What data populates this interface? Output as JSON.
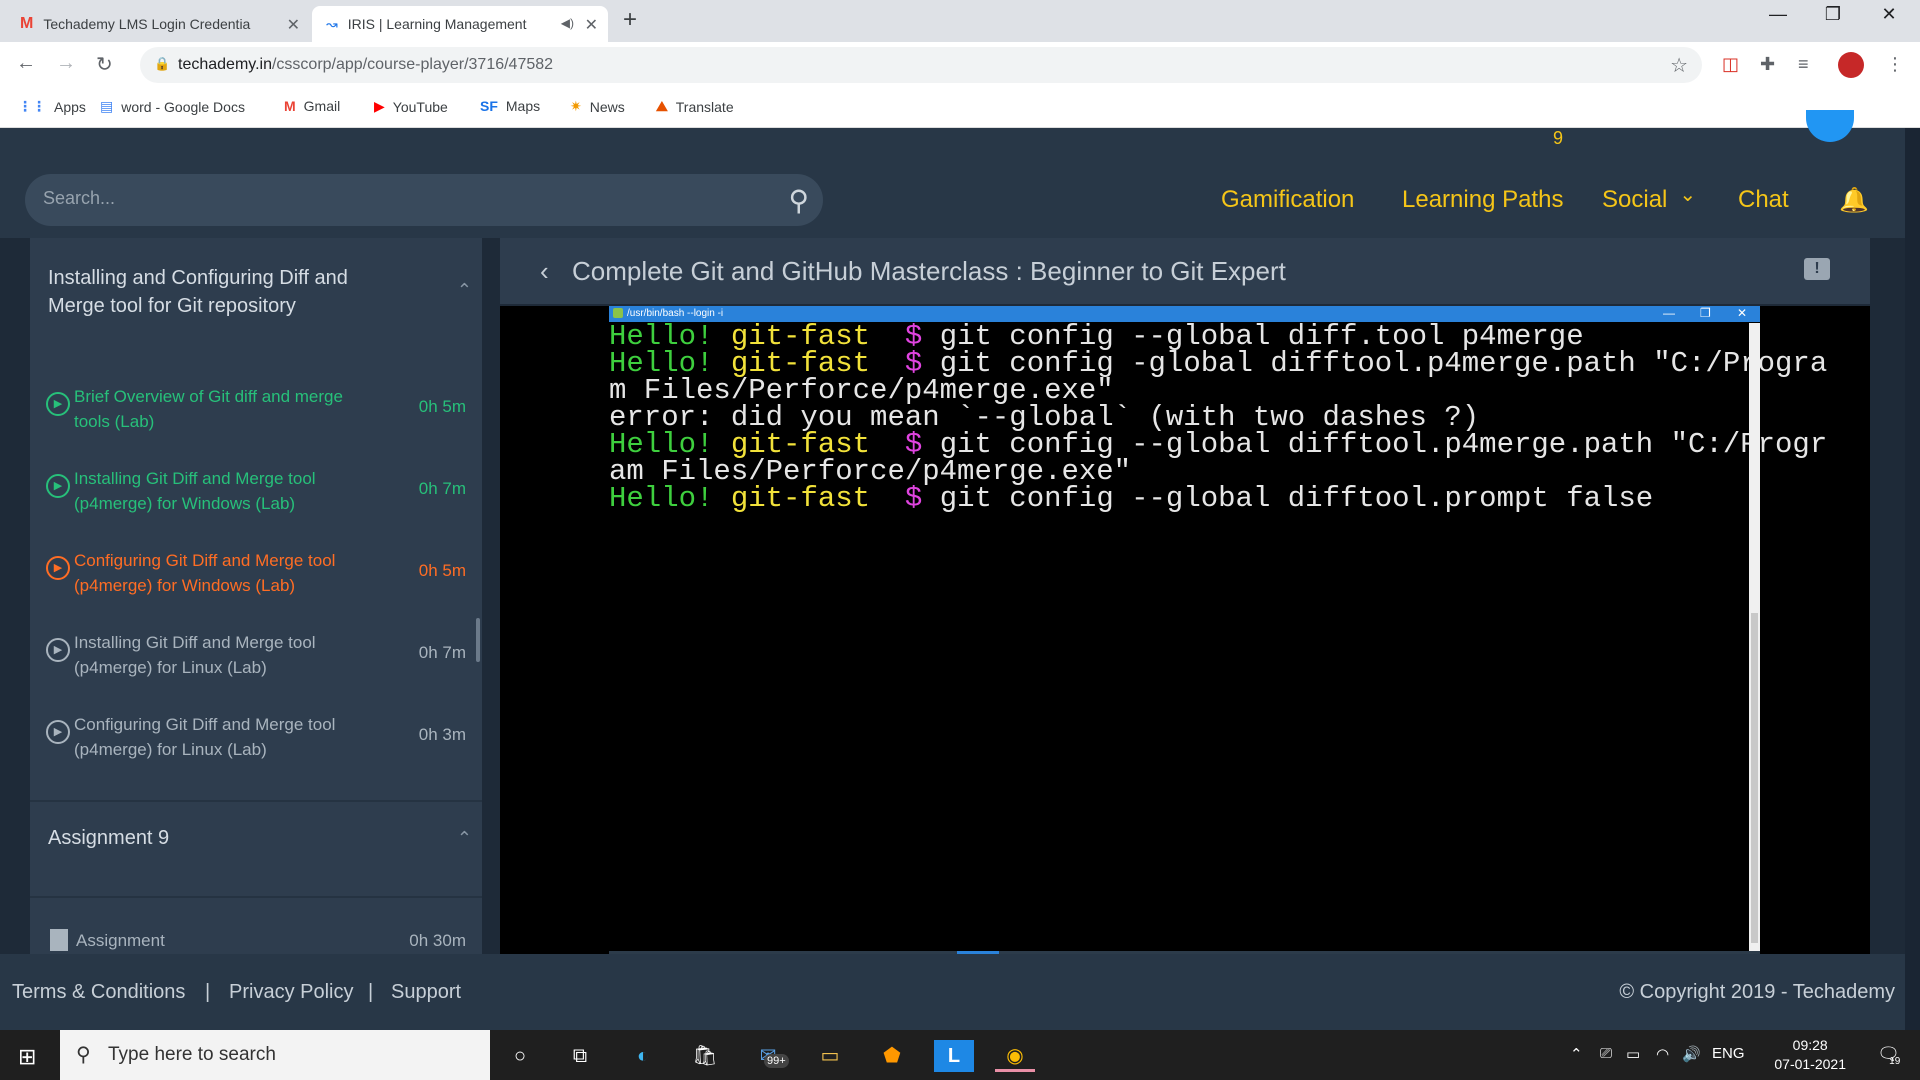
{
  "browser": {
    "tabs": [
      {
        "title": "Techademy LMS Login Credentia",
        "icon": "gmail-icon"
      },
      {
        "title": "IRIS | Learning Management",
        "icon": "iris-icon"
      }
    ],
    "url_host": "techademy.in",
    "url_path": "/csscorp/app/course-player/3716/47582",
    "bookmarks": [
      "Apps",
      "word - Google Docs",
      "Gmail",
      "YouTube",
      "Maps",
      "News",
      "Translate"
    ],
    "bookmark_prefix_maps": "SF"
  },
  "header": {
    "count": "9",
    "search_placeholder": "Search...",
    "nav": [
      "Gamification",
      "Learning Paths",
      "Social",
      "Chat"
    ],
    "social_chevron": "⌄"
  },
  "sidebar": {
    "section1_title": "Installing and Configuring Diff and Merge tool for Git repository",
    "lessons": [
      {
        "name": "Brief Overview of Git diff and merge tools (Lab)",
        "duration": "0h 5m",
        "state": "done"
      },
      {
        "name": "Installing Git Diff and Merge tool (p4merge) for Windows (Lab)",
        "duration": "0h 7m",
        "state": "done"
      },
      {
        "name": "Configuring Git Diff and Merge tool (p4merge) for Windows (Lab)",
        "duration": "0h 5m",
        "state": "current"
      },
      {
        "name": "Installing Git Diff and Merge tool (p4merge) for Linux (Lab)",
        "duration": "0h 7m",
        "state": "pending"
      },
      {
        "name": "Configuring Git Diff and Merge tool (p4merge) for Linux (Lab)",
        "duration": "0h 3m",
        "state": "pending"
      }
    ],
    "section2_title": "Assignment 9",
    "assignment": {
      "name": "Assignment",
      "duration": "0h 30m"
    }
  },
  "main": {
    "course_title": "Complete Git and GitHub Masterclass : Beginner to Git Expert",
    "terminal": {
      "window_title": "/usr/bin/bash --login -i",
      "prompt_user": "Hello!",
      "prompt_dir": "git-fast",
      "prompt_sym": "$",
      "cmd1": "git config --global diff.tool p4merge",
      "cmd2a": "git config -global difftool.p4merge.path \"C:/Progra",
      "cmd2b": "m Files/Perforce/p4merge.exe\"",
      "err": "error: did you mean `--global` (with two dashes ?)",
      "cmd3a": "git config --global difftool.p4merge.path \"C:/Progr",
      "cmd3b": "am Files/Perforce/p4merge.exe\"",
      "cmd4": "git config --global difftool.prompt false"
    }
  },
  "footer": {
    "links": [
      "Terms & Conditions",
      "Privacy Policy",
      "Support"
    ],
    "separator": "|",
    "copyright": "© Copyright 2019 - Techademy"
  },
  "taskbar": {
    "search_placeholder": "Type here to search",
    "mail_badge": "99+",
    "lang": "ENG",
    "time": "09:28",
    "date": "07-01-2021",
    "notif_count": "19"
  }
}
